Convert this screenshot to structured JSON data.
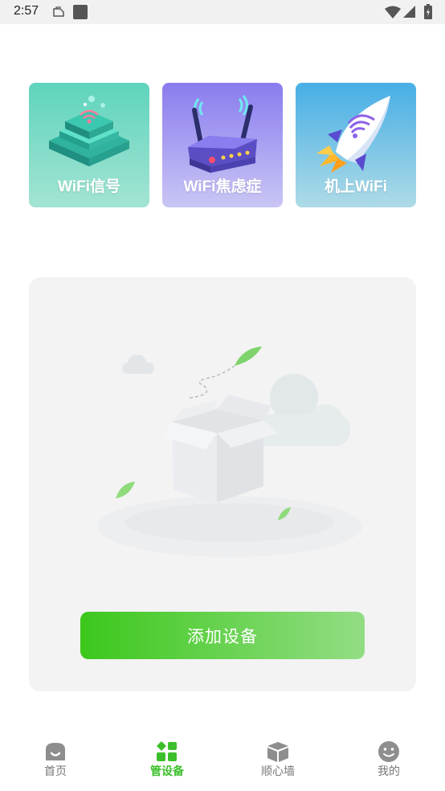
{
  "status_bar": {
    "time": "2:57",
    "icons": [
      "note-icon",
      "square-app-icon",
      "wifi-icon",
      "signal-icon",
      "battery-icon"
    ]
  },
  "feature_cards": [
    {
      "label": "WiFi信号",
      "icon": "router-stack-icon",
      "color_top": "#5fd4bc"
    },
    {
      "label": "WiFi焦虑症",
      "icon": "wireless-router-icon",
      "color_top": "#8a7cee"
    },
    {
      "label": "机上WiFi",
      "icon": "rocket-icon",
      "color_top": "#47aee5"
    }
  ],
  "empty_state": {
    "illustration": "empty-box-illustration",
    "add_button_label": "添加设备",
    "accent_color": "#3cc81c"
  },
  "tab_bar": {
    "active": 1,
    "tabs": [
      {
        "label": "首页",
        "icon": "home-icon"
      },
      {
        "label": "管设备",
        "icon": "grid-icon"
      },
      {
        "label": "顺心墙",
        "icon": "cube-icon"
      },
      {
        "label": "我的",
        "icon": "smile-icon"
      }
    ]
  }
}
